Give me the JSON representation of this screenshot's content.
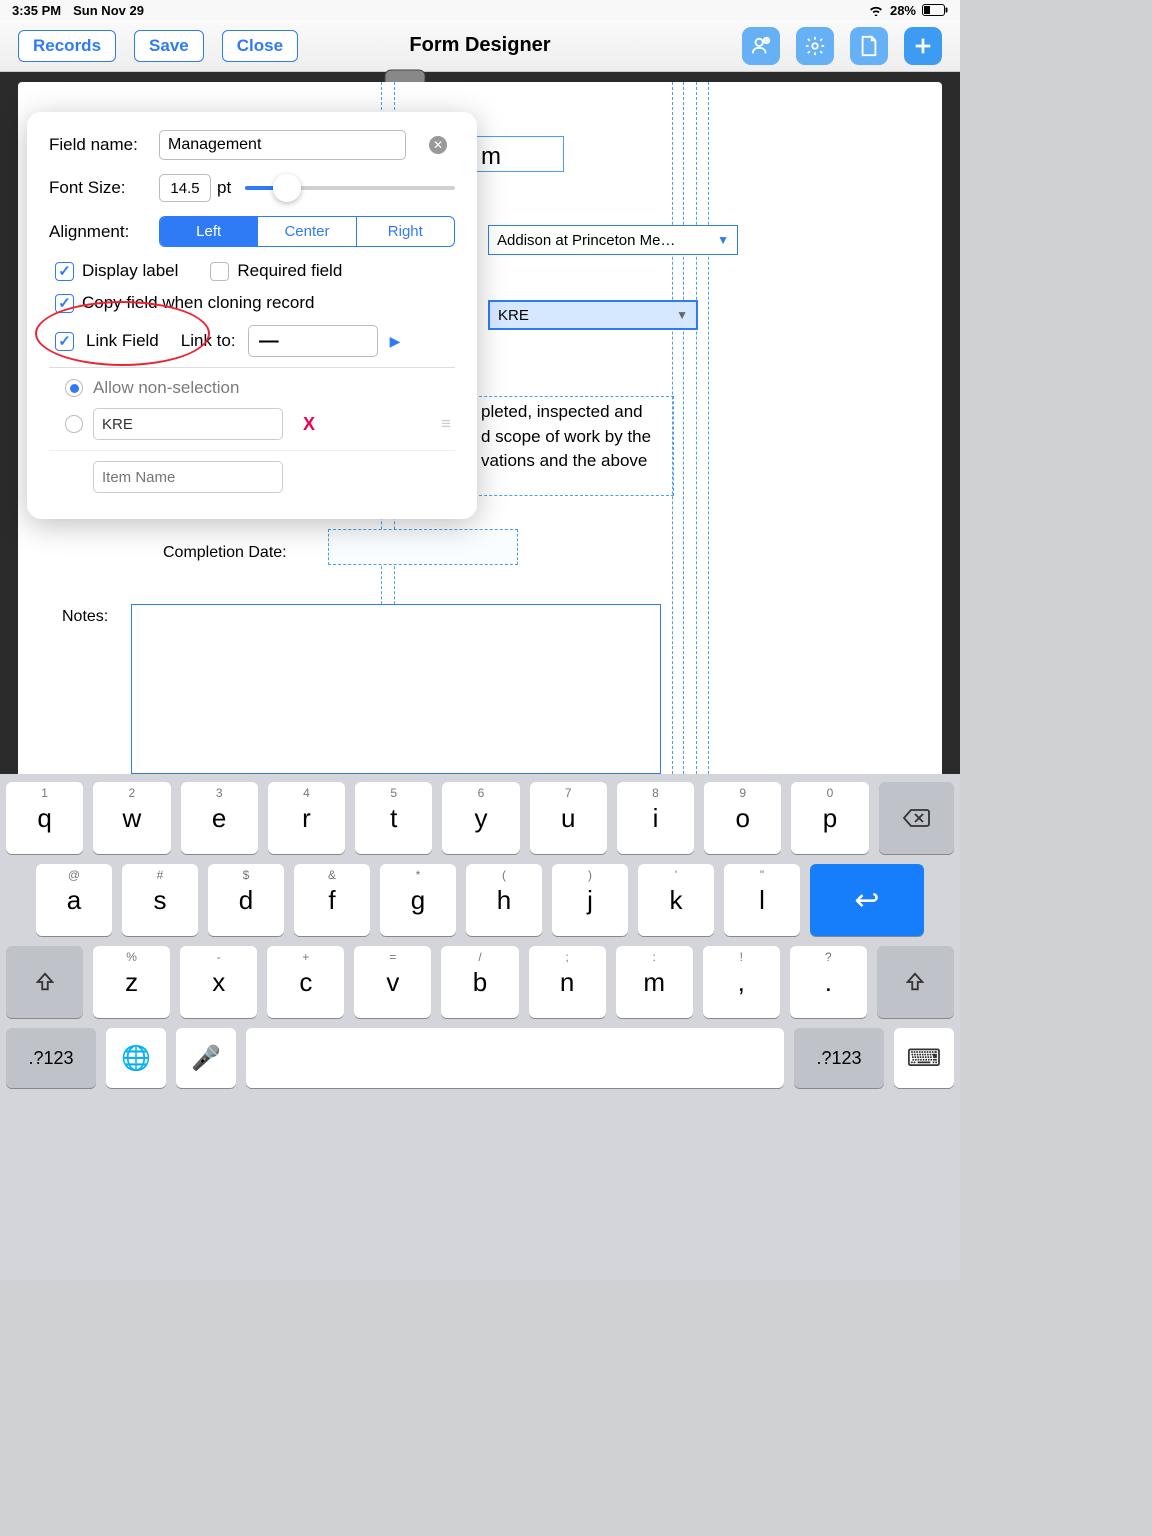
{
  "status": {
    "time": "3:35 PM",
    "date": "Sun Nov 29",
    "battery_pct": "28%"
  },
  "toolbar": {
    "records": "Records",
    "save": "Save",
    "close": "Close",
    "title": "Form Designer"
  },
  "popover": {
    "field_name_label": "Field name:",
    "field_name_value": "Management ",
    "font_size_label": "Font Size:",
    "font_size_value": "14.5",
    "pt": "pt",
    "alignment_label": "Alignment:",
    "seg": {
      "left": "Left",
      "center": "Center",
      "right": "Right"
    },
    "display_label": "Display label",
    "required": "Required field",
    "copy_clone": "Copy field when cloning record",
    "link_field": "Link Field",
    "link_to": "Link to:",
    "link_to_value": "—",
    "allow_non": "Allow non-selection",
    "item0": "KRE",
    "item_ph": "Item Name",
    "del": "X"
  },
  "form": {
    "title_fragment": "m",
    "combo1": "Addison at Princeton Me…",
    "combo2": "KRE",
    "body_text_1": "pleted, inspected and",
    "body_text_2": "d scope of work by the",
    "body_text_3": "vations and the above",
    "completion": "Completion Date:",
    "notes": "Notes:"
  },
  "keyboard": {
    "row1": [
      {
        "alt": "1",
        "main": "q"
      },
      {
        "alt": "2",
        "main": "w"
      },
      {
        "alt": "3",
        "main": "e"
      },
      {
        "alt": "4",
        "main": "r"
      },
      {
        "alt": "5",
        "main": "t"
      },
      {
        "alt": "6",
        "main": "y"
      },
      {
        "alt": "7",
        "main": "u"
      },
      {
        "alt": "8",
        "main": "i"
      },
      {
        "alt": "9",
        "main": "o"
      },
      {
        "alt": "0",
        "main": "p"
      }
    ],
    "row2": [
      {
        "alt": "@",
        "main": "a"
      },
      {
        "alt": "#",
        "main": "s"
      },
      {
        "alt": "$",
        "main": "d"
      },
      {
        "alt": "&",
        "main": "f"
      },
      {
        "alt": "*",
        "main": "g"
      },
      {
        "alt": "(",
        "main": "h"
      },
      {
        "alt": ")",
        "main": "j"
      },
      {
        "alt": "'",
        "main": "k"
      },
      {
        "alt": "\"",
        "main": "l"
      }
    ],
    "row3": [
      {
        "alt": "%",
        "main": "z"
      },
      {
        "alt": "-",
        "main": "x"
      },
      {
        "alt": "+",
        "main": "c"
      },
      {
        "alt": "=",
        "main": "v"
      },
      {
        "alt": "/",
        "main": "b"
      },
      {
        "alt": ";",
        "main": "n"
      },
      {
        "alt": ":",
        "main": "m"
      },
      {
        "alt": "!",
        "main": ","
      },
      {
        "alt": "?",
        "main": "."
      }
    ],
    "sym": ".?123"
  }
}
